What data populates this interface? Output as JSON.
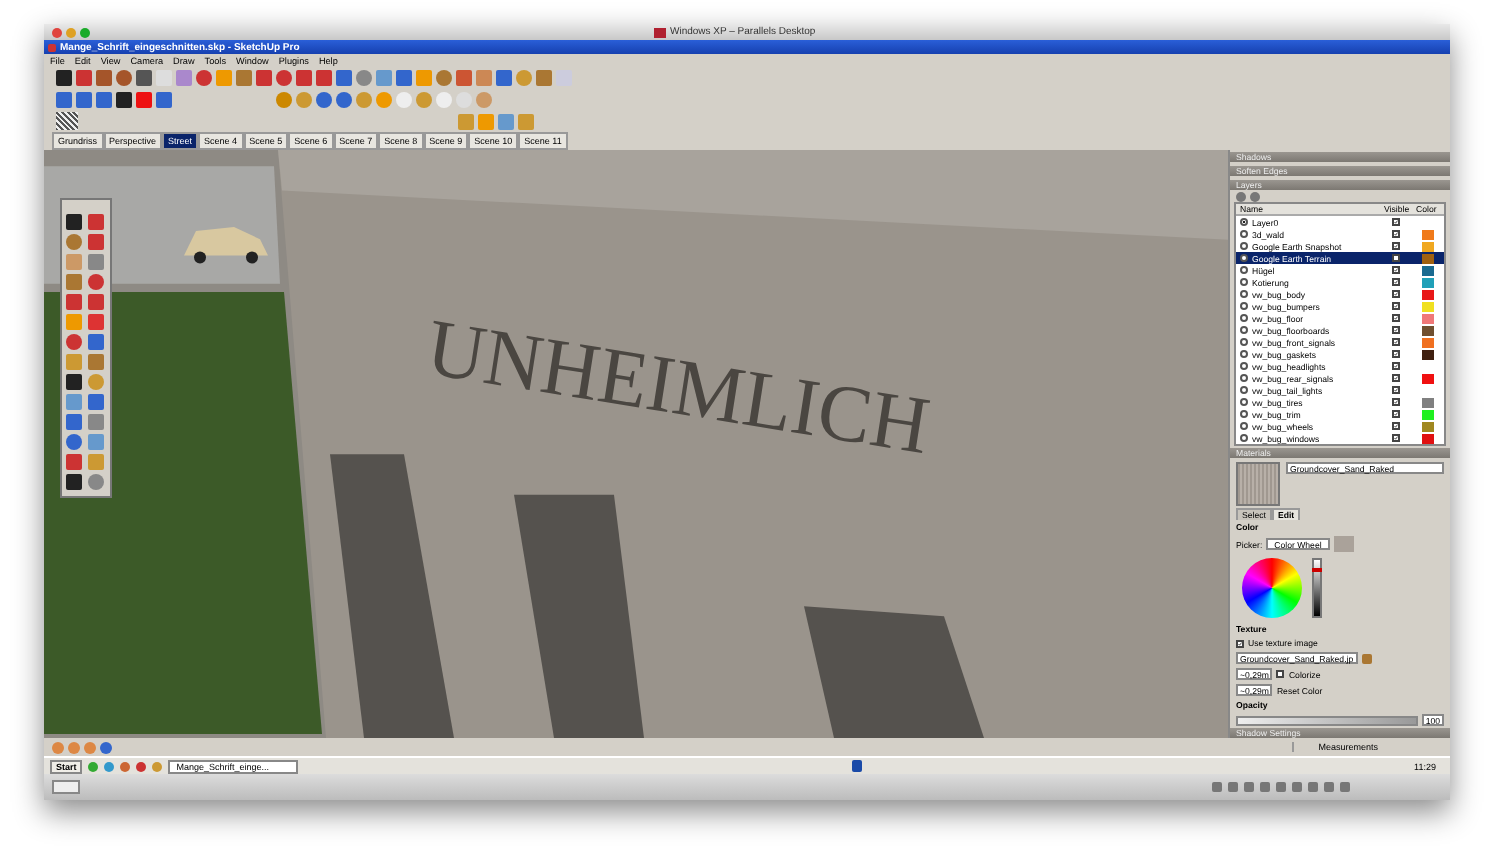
{
  "mac_window": {
    "title": "Windows XP – Parallels Desktop"
  },
  "app": {
    "title": "Mange_Schrift_eingeschnitten.skp - SketchUp Pro"
  },
  "menu": [
    "File",
    "Edit",
    "View",
    "Camera",
    "Draw",
    "Tools",
    "Window",
    "Plugins",
    "Help"
  ],
  "scene_tabs": [
    {
      "label": "Grundriss",
      "selected": false
    },
    {
      "label": "Perspective",
      "selected": false
    },
    {
      "label": "Street",
      "selected": true
    },
    {
      "label": "Scene 4",
      "selected": false
    },
    {
      "label": "Scene 5",
      "selected": false
    },
    {
      "label": "Scene 6",
      "selected": false
    },
    {
      "label": "Scene 7",
      "selected": false
    },
    {
      "label": "Scene 8",
      "selected": false
    },
    {
      "label": "Scene 9",
      "selected": false
    },
    {
      "label": "Scene 10",
      "selected": false
    },
    {
      "label": "Scene 11",
      "selected": false
    }
  ],
  "viewport": {
    "engraving": "UNHEIMLICH"
  },
  "tray_panels": [
    {
      "title": "Shadows"
    },
    {
      "title": "Soften Edges"
    }
  ],
  "layers": {
    "title": "Layers",
    "columns": [
      "Name",
      "Visible",
      "Color"
    ],
    "rows": [
      {
        "name": "Layer0",
        "selected": true,
        "visible": true,
        "highlighted": false
      },
      {
        "name": "3d_wald",
        "selected": false,
        "visible": true,
        "highlighted": false,
        "color": "#f07a1a"
      },
      {
        "name": "Google Earth Snapshot",
        "selected": false,
        "visible": true,
        "highlighted": false,
        "color": "#f0a820"
      },
      {
        "name": "Google Earth Terrain",
        "selected": false,
        "visible": false,
        "highlighted": true,
        "color": "#a06010"
      },
      {
        "name": "Hügel",
        "selected": false,
        "visible": true,
        "highlighted": false,
        "color": "#1a6a90"
      },
      {
        "name": "Kotierung",
        "selected": false,
        "visible": true,
        "highlighted": false,
        "color": "#20a0b8"
      },
      {
        "name": "vw_bug_body",
        "selected": false,
        "visible": true,
        "highlighted": false,
        "color": "#e81818"
      },
      {
        "name": "vw_bug_bumpers",
        "selected": false,
        "visible": true,
        "highlighted": false,
        "color": "#f0e020"
      },
      {
        "name": "vw_bug_floor",
        "selected": false,
        "visible": true,
        "highlighted": false,
        "color": "#f07878"
      },
      {
        "name": "vw_bug_floorboards",
        "selected": false,
        "visible": true,
        "highlighted": false,
        "color": "#705030"
      },
      {
        "name": "vw_bug_front_signals",
        "selected": false,
        "visible": true,
        "highlighted": false,
        "color": "#f07020"
      },
      {
        "name": "vw_bug_gaskets",
        "selected": false,
        "visible": true,
        "highlighted": false,
        "color": "#402010"
      },
      {
        "name": "vw_bug_headlights",
        "selected": false,
        "visible": true,
        "highlighted": false
      },
      {
        "name": "vw_bug_rear_signals",
        "selected": false,
        "visible": true,
        "highlighted": false,
        "color": "#f01010"
      },
      {
        "name": "vw_bug_tail_lights",
        "selected": false,
        "visible": true,
        "highlighted": false
      },
      {
        "name": "vw_bug_tires",
        "selected": false,
        "visible": true,
        "highlighted": false,
        "color": "#808080"
      },
      {
        "name": "vw_bug_trim",
        "selected": false,
        "visible": true,
        "highlighted": false,
        "color": "#20f020"
      },
      {
        "name": "vw_bug_wheels",
        "selected": false,
        "visible": true,
        "highlighted": false,
        "color": "#a08820"
      },
      {
        "name": "vw_bug_windows",
        "selected": false,
        "visible": true,
        "highlighted": false,
        "color": "#e01010"
      }
    ]
  },
  "materials": {
    "title": "Materials",
    "name": "Groundcover_Sand_Raked",
    "tabs": [
      {
        "label": "Select",
        "selected": false
      },
      {
        "label": "Edit",
        "selected": true
      }
    ],
    "color_label": "Color",
    "picker_label": "Picker:",
    "picker": "Color Wheel",
    "brightness": {
      "level": 0.85
    },
    "texture_label": "Texture",
    "use_texture": {
      "label": "Use texture image",
      "checked": true
    },
    "texture_file": "Groundcover_Sand_Raked.jp",
    "width": "~0,29m",
    "height": "~0,29m",
    "colorize": {
      "label": "Colorize",
      "checked": false
    },
    "reset": "Reset Color",
    "opacity_label": "Opacity",
    "opacity": {
      "level": 1.0,
      "value": "100"
    }
  },
  "shadow_settings": {
    "title": "Shadow Settings"
  },
  "measurements": {
    "label": "Measurements"
  },
  "taskbar": {
    "start": "Start",
    "task": "Mange_Schrift_einge...",
    "clock": "11:29"
  }
}
